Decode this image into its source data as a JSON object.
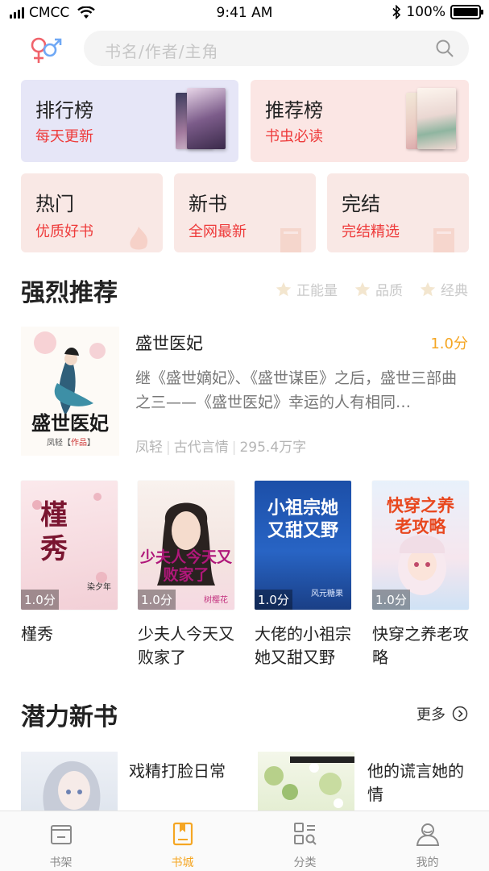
{
  "status_bar": {
    "carrier": "CMCC",
    "time": "9:41 AM",
    "battery": "100%"
  },
  "search": {
    "placeholder": "书名/作者/主角"
  },
  "categories": {
    "big": [
      {
        "title": "排行榜",
        "subtitle": "每天更新"
      },
      {
        "title": "推荐榜",
        "subtitle": "书虫必读"
      }
    ],
    "small": [
      {
        "title": "热门",
        "subtitle": "优质好书"
      },
      {
        "title": "新书",
        "subtitle": "全网最新"
      },
      {
        "title": "完结",
        "subtitle": "完结精选"
      }
    ]
  },
  "recommend": {
    "title": "强烈推荐",
    "tags": [
      "正能量",
      "品质",
      "经典"
    ],
    "featured": {
      "title": "盛世医妃",
      "score": "1.0分",
      "description": "继《盛世嫡妃》、《盛世谋臣》之后，盛世三部曲之三——《盛世医妃》幸运的人有相同…",
      "author": "凤轻",
      "genre": "古代言情",
      "words": "295.4万字",
      "cover_text": "盛世医妃",
      "cover_author": "凤轻",
      "cover_tag": "作品"
    },
    "books": [
      {
        "title": "槿秀",
        "score": "1.0分",
        "cover_text": "槿秀",
        "cover_author": "染夕年"
      },
      {
        "title": "少夫人今天又败家了",
        "score": "1.0分",
        "cover_text": "少夫人今天又败家了",
        "cover_author": "树樱花"
      },
      {
        "title": "大佬的小祖宗她又甜又野",
        "score": "1.0分",
        "cover_text": "小祖宗她又甜又野",
        "cover_author": "风元糖果"
      },
      {
        "title": "快穿之养老攻略",
        "score": "1.0分",
        "cover_text": "快穿之养老攻略"
      }
    ]
  },
  "new_books": {
    "title": "潜力新书",
    "more": "更多",
    "books": [
      {
        "title": "戏精打脸日常"
      },
      {
        "title": "他的谎言她的情"
      }
    ]
  },
  "tabbar": {
    "items": [
      {
        "label": "书架",
        "icon": "bookshelf-icon"
      },
      {
        "label": "书城",
        "icon": "bookstore-icon"
      },
      {
        "label": "分类",
        "icon": "category-icon"
      },
      {
        "label": "我的",
        "icon": "profile-icon"
      }
    ],
    "active_index": 1
  },
  "colors": {
    "accent": "#f5a623",
    "subtitle_red": "#ee3b3b",
    "rank_card_bg": "#e6e6f7",
    "pink_card_bg": "#fbe6e4"
  }
}
